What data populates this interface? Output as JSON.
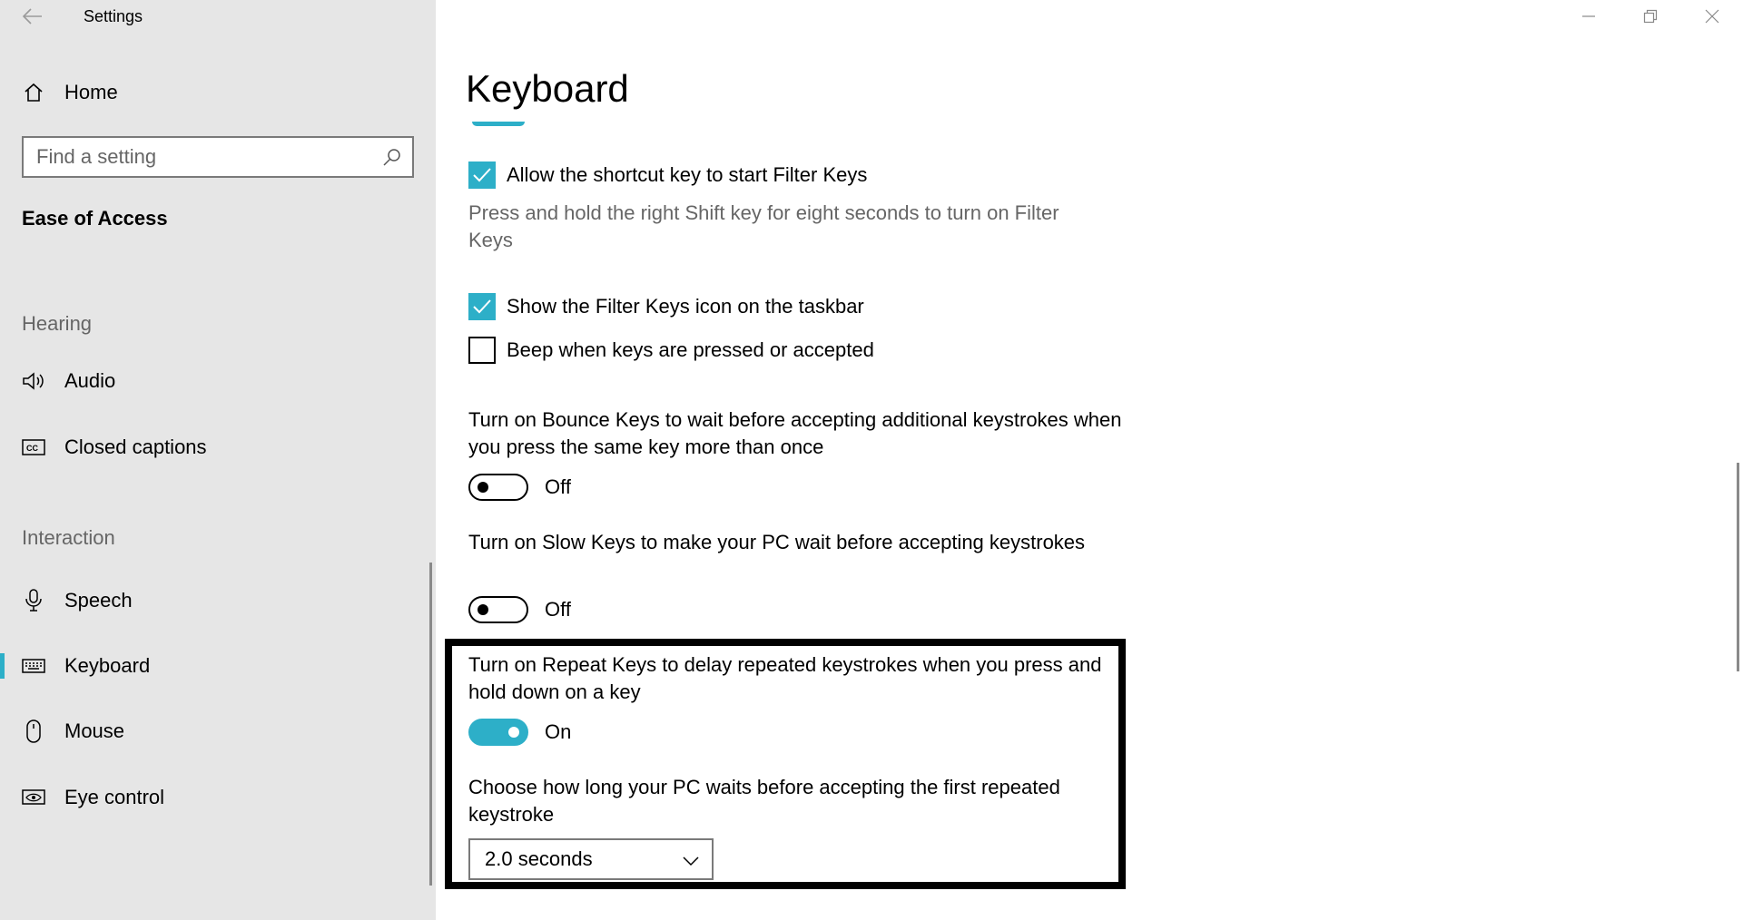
{
  "window": {
    "app_title": "Settings"
  },
  "sidebar": {
    "home_label": "Home",
    "search_placeholder": "Find a setting",
    "section_title": "Ease of Access",
    "groups": [
      {
        "header": "Hearing",
        "items": [
          {
            "label": "Audio",
            "icon": "speaker-icon"
          },
          {
            "label": "Closed captions",
            "icon": "closed-captions-icon"
          }
        ]
      },
      {
        "header": "Interaction",
        "items": [
          {
            "label": "Speech",
            "icon": "microphone-icon"
          },
          {
            "label": "Keyboard",
            "icon": "keyboard-icon",
            "selected": true
          },
          {
            "label": "Mouse",
            "icon": "mouse-icon"
          },
          {
            "label": "Eye control",
            "icon": "eye-control-icon"
          }
        ]
      }
    ]
  },
  "main": {
    "title": "Keyboard",
    "filter_shortcut": {
      "label": "Allow the shortcut key to start Filter Keys",
      "checked": true,
      "description": "Press and hold the right Shift key for eight seconds to turn on Filter Keys"
    },
    "filter_icon": {
      "label": "Show the Filter Keys icon on the taskbar",
      "checked": true
    },
    "beep": {
      "label": "Beep when keys are pressed or accepted",
      "checked": false
    },
    "bounce_keys": {
      "text": "Turn on Bounce Keys to wait before accepting additional keystrokes when you press the same key more than once",
      "state": "Off"
    },
    "slow_keys": {
      "text": "Turn on Slow Keys to make your PC wait before accepting keystrokes",
      "state": "Off"
    },
    "repeat_keys": {
      "text": "Turn on Repeat Keys to delay repeated keystrokes when you press and hold down on a key",
      "state": "On"
    },
    "repeat_delay": {
      "text": "Choose how long your PC waits before accepting the first repeated keystroke",
      "value": "2.0 seconds"
    }
  },
  "colors": {
    "accent": "#2dafc8",
    "sidebar_bg": "#e6e6e6",
    "secondary_text": "#666666"
  }
}
